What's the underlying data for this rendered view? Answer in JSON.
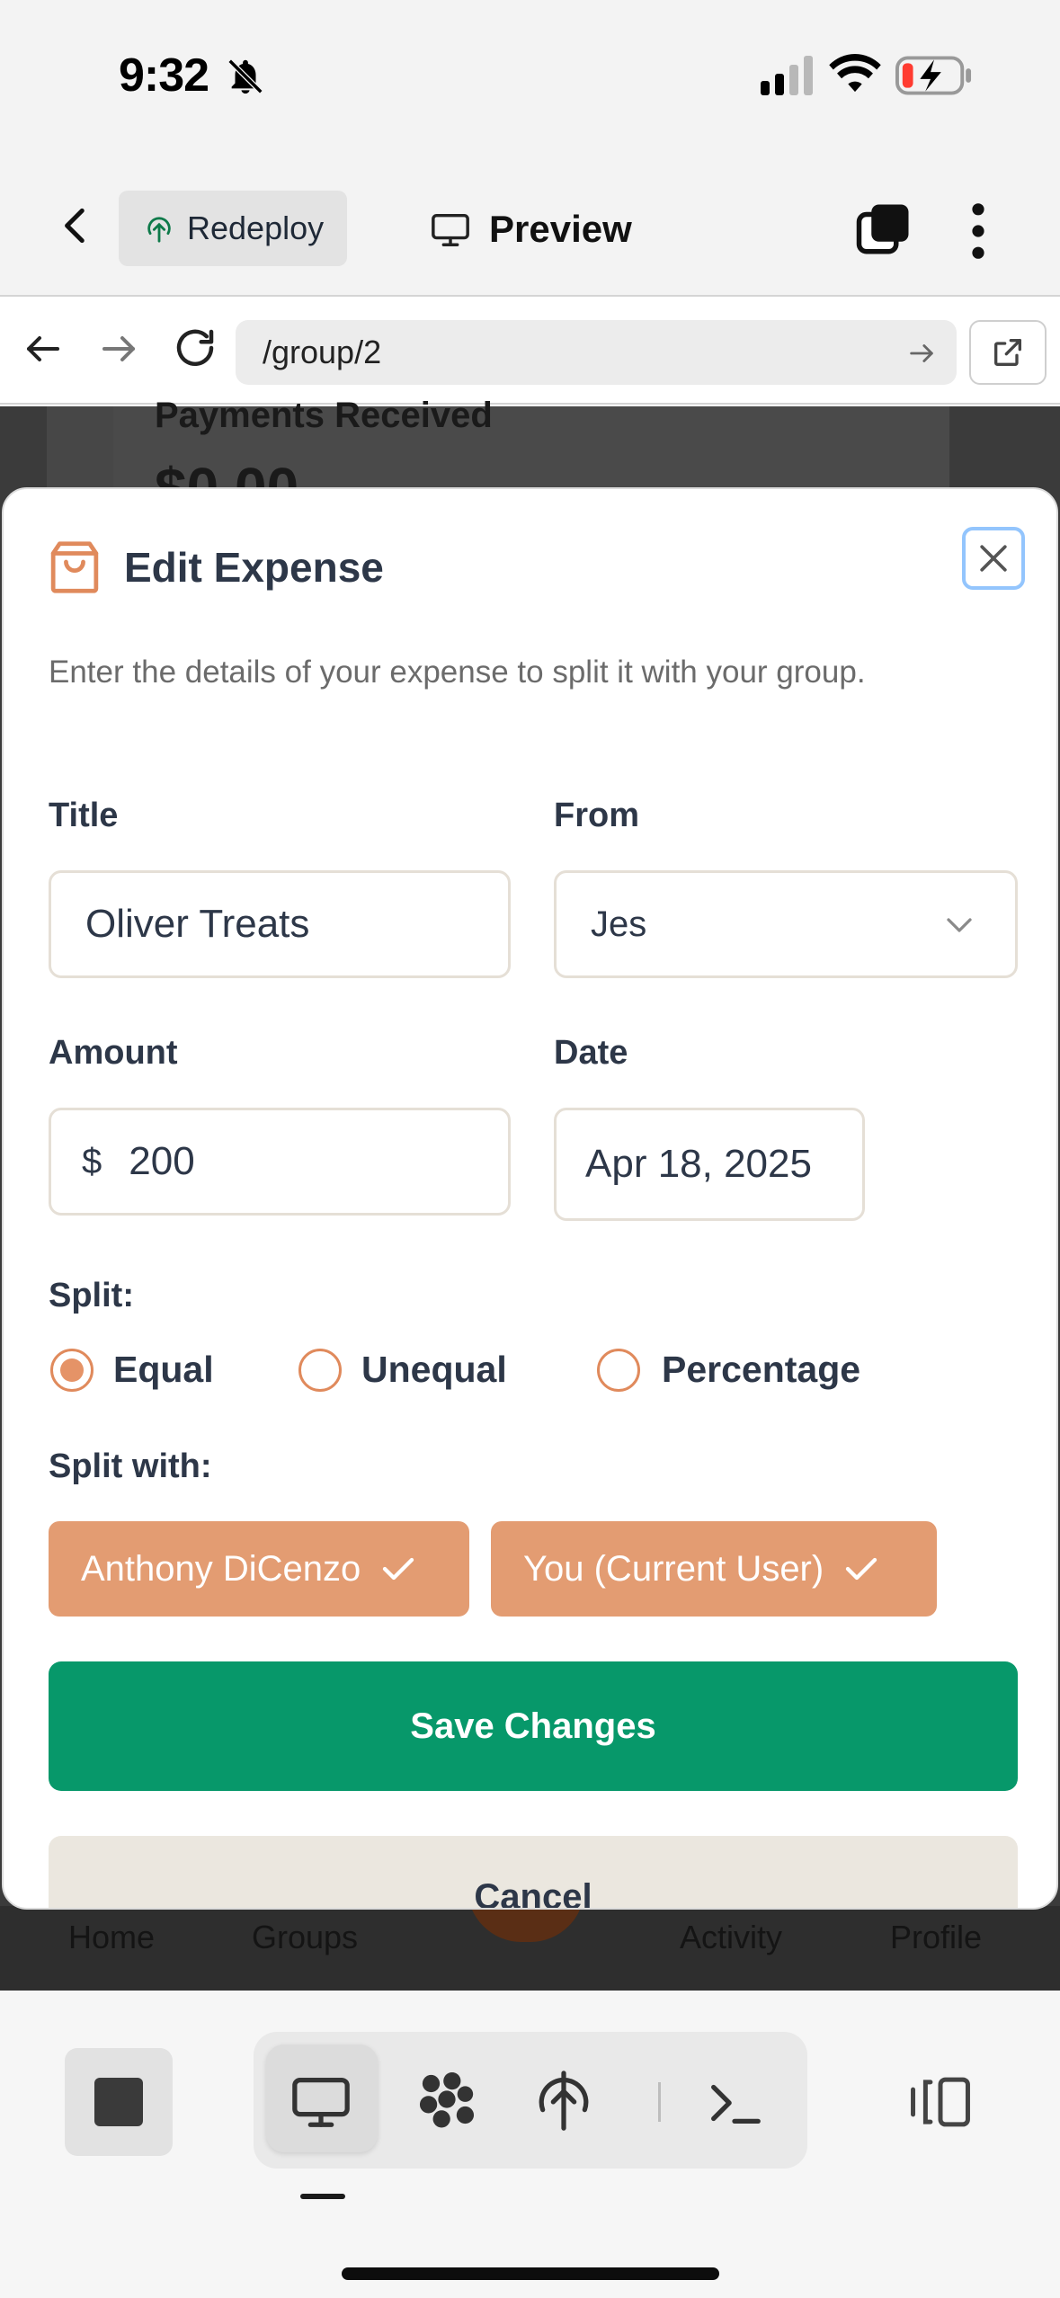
{
  "status_bar": {
    "time": "9:32"
  },
  "top_bar": {
    "redeploy_label": "Redeploy",
    "preview_label": "Preview"
  },
  "url_bar": {
    "url": "/group/2"
  },
  "background_page": {
    "payments_label": "Payments Received",
    "payments_amount": "$0.00",
    "nav": {
      "home": "Home",
      "groups": "Groups",
      "activity": "Activity",
      "profile": "Profile"
    }
  },
  "modal": {
    "title": "Edit Expense",
    "description": "Enter the details of your expense to split it with your group.",
    "title_label": "Title",
    "title_value": "Oliver Treats",
    "from_label": "From",
    "from_value": "Jes",
    "amount_label": "Amount",
    "currency_symbol": "$",
    "amount_value": "200",
    "date_label": "Date",
    "date_value": "Apr 18, 2025",
    "split_label": "Split:",
    "split_options": [
      {
        "label": "Equal",
        "selected": true
      },
      {
        "label": "Unequal",
        "selected": false
      },
      {
        "label": "Percentage",
        "selected": false
      }
    ],
    "split_with_label": "Split with:",
    "split_with": [
      {
        "name": "Anthony DiCenzo",
        "selected": true
      },
      {
        "name": "You (Current User)",
        "selected": true
      }
    ],
    "save_label": "Save Changes",
    "cancel_label": "Cancel"
  },
  "colors": {
    "accent_orange": "#e39c72",
    "save_green": "#07986a",
    "cancel_beige": "#ebe7df",
    "text_dark": "#2d3748"
  },
  "icons": {
    "modal_icon": "shopping-bag-icon",
    "close": "close-icon",
    "dropdown": "chevron-down-icon"
  }
}
